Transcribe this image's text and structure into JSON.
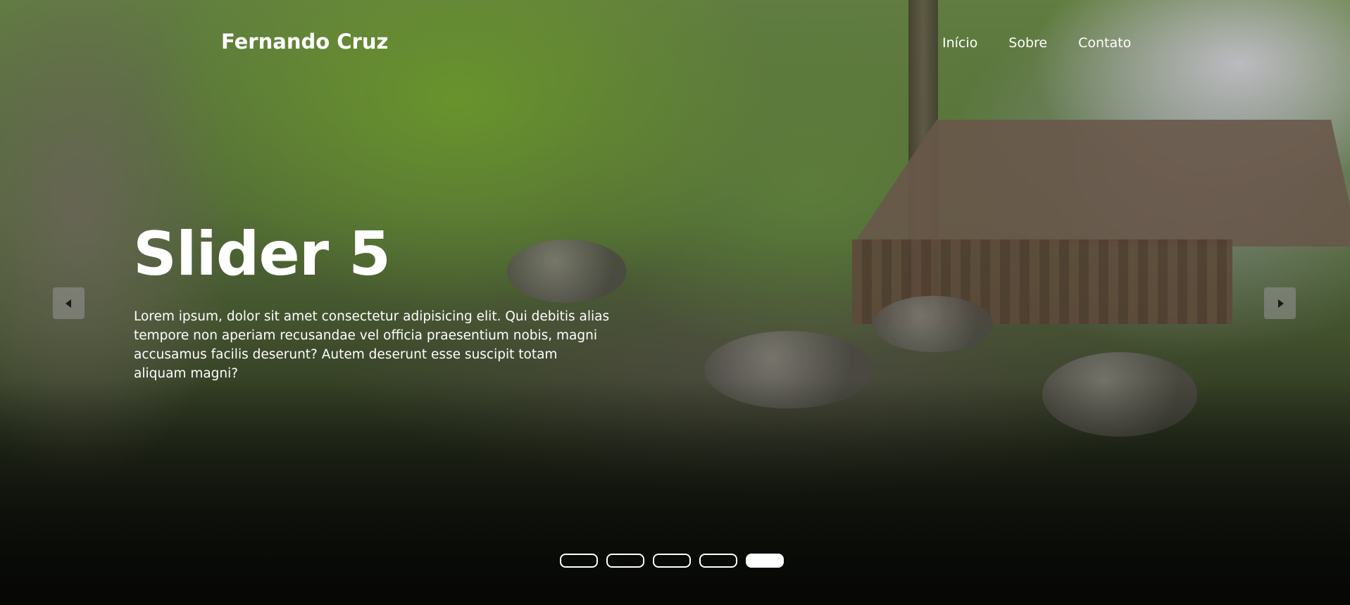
{
  "header": {
    "brand": "Fernando Cruz",
    "nav": [
      "Início",
      "Sobre",
      "Contato"
    ]
  },
  "slide": {
    "title": "Slider 5",
    "text": "Lorem ipsum, dolor sit amet consectetur adipisicing elit. Qui debitis alias tempore non aperiam recusandae vel officia praesentium nobis, magni accusamus facilis deserunt? Autem deserunt esse suscipit totam aliquam magni?"
  },
  "controls": {
    "prev_icon": "caret-left-icon",
    "next_icon": "caret-right-icon"
  },
  "pagination": {
    "total": 5,
    "active_index": 4
  },
  "colors": {
    "text": "#ffffff",
    "arrow_bg": "#969696"
  }
}
